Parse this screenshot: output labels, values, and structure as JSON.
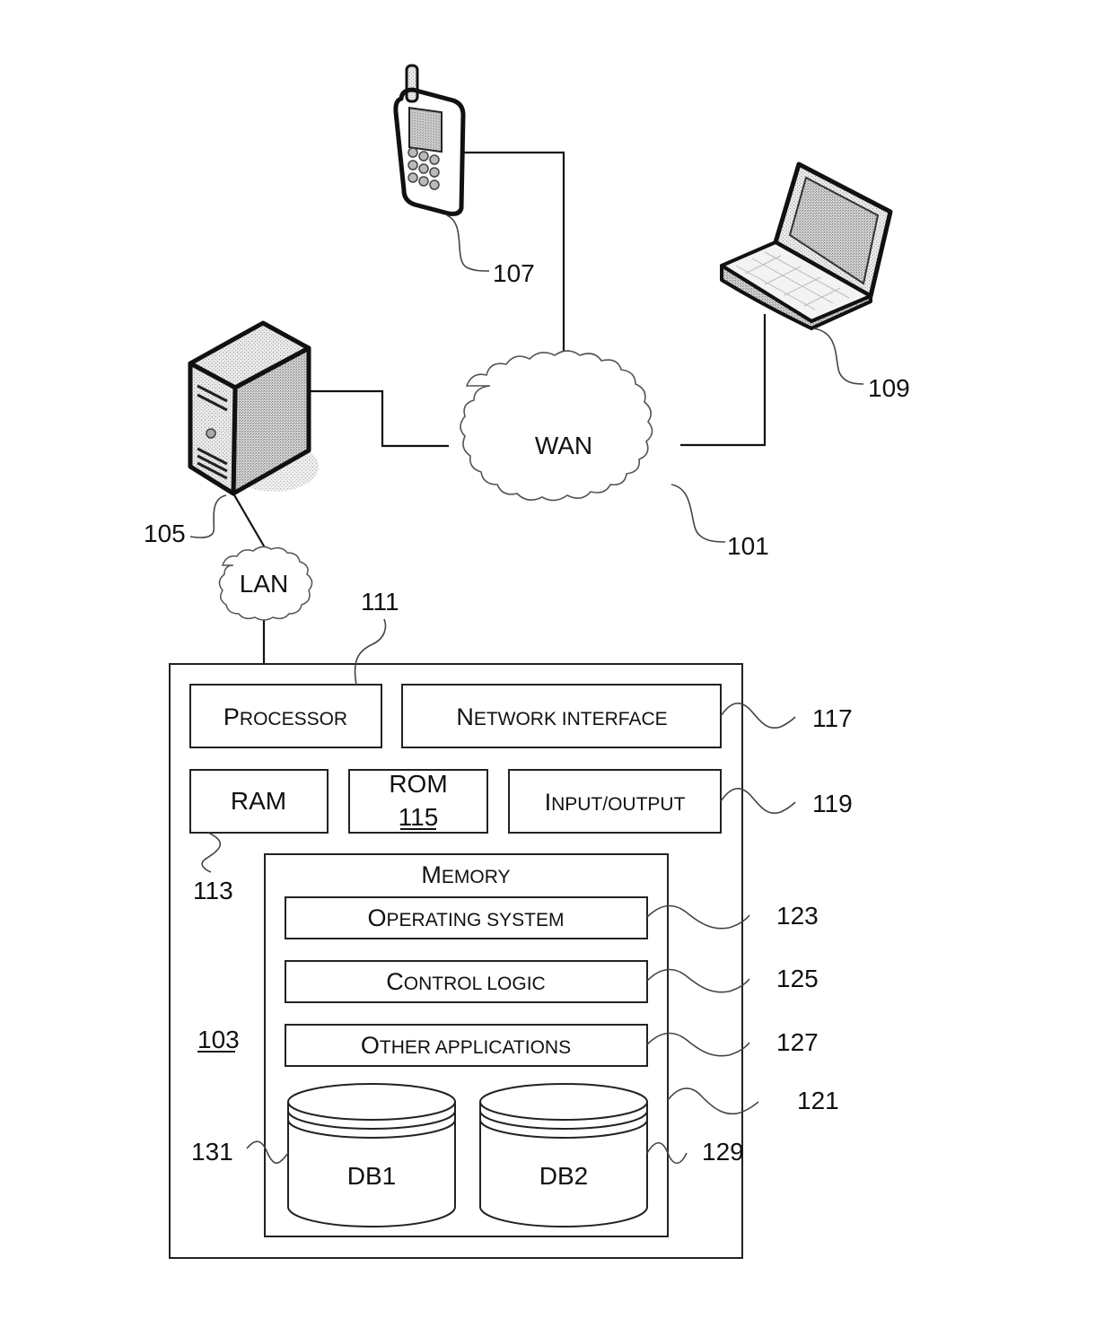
{
  "figure": {
    "type": "network system block diagram",
    "devices": {
      "mobile_phone": {
        "ref": "107"
      },
      "laptop": {
        "ref": "109"
      },
      "server": {
        "ref": "105"
      }
    },
    "networks": {
      "wan": {
        "label": "WAN",
        "ref": "101"
      },
      "lan": {
        "label": "LAN"
      }
    },
    "device_box": {
      "ref": "103",
      "components": {
        "processor": {
          "label_cap": "P",
          "label_rest": "ROCESSOR",
          "ref": "111"
        },
        "network_interface": {
          "label_cap": "N",
          "label_rest": "ETWORK INTERFACE",
          "ref": "117"
        },
        "ram": {
          "label": "RAM",
          "ref": "113"
        },
        "rom": {
          "label": "ROM",
          "ref": "115"
        },
        "io": {
          "label_cap": "I",
          "label_rest": "NPUT/OUTPUT",
          "ref": "119"
        }
      },
      "memory": {
        "label_cap": "M",
        "label_rest": "EMORY",
        "ref": "121",
        "items": [
          {
            "label_cap": "O",
            "label_rest": "PERATING SYSTEM",
            "ref": "123"
          },
          {
            "label_cap": "C",
            "label_rest": "ONTROL LOGIC",
            "ref": "125"
          },
          {
            "label_cap": "O",
            "label_rest": "THER APPLICATIONS",
            "ref": "127"
          }
        ],
        "databases": [
          {
            "label": "DB1",
            "ref": "131"
          },
          {
            "label": "DB2",
            "ref": "129"
          }
        ]
      }
    }
  }
}
